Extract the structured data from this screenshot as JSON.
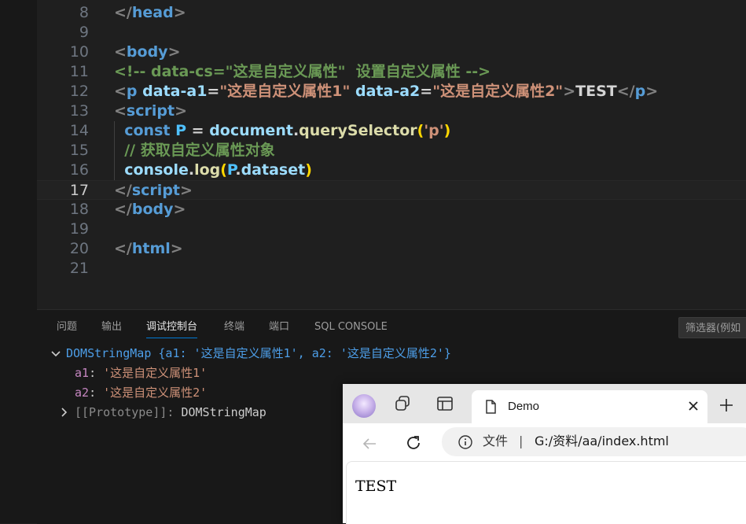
{
  "editor": {
    "lines": [
      {
        "num": "8",
        "tokens": [
          {
            "t": "punc",
            "v": "</"
          },
          {
            "t": "tag",
            "v": "head"
          },
          {
            "t": "punc",
            "v": ">"
          }
        ]
      },
      {
        "num": "9",
        "tokens": []
      },
      {
        "num": "10",
        "tokens": [
          {
            "t": "punc",
            "v": "<"
          },
          {
            "t": "tag",
            "v": "body"
          },
          {
            "t": "punc",
            "v": ">"
          }
        ]
      },
      {
        "num": "11",
        "tokens": [
          {
            "t": "cmt",
            "v": "<!-- data-cs=\"这是自定义属性\"  设置自定义属性 -->"
          }
        ]
      },
      {
        "num": "12",
        "tokens": [
          {
            "t": "punc",
            "v": "<"
          },
          {
            "t": "tag",
            "v": "p"
          },
          {
            "t": "plain",
            "v": " "
          },
          {
            "t": "attr",
            "v": "data-a1"
          },
          {
            "t": "plain",
            "v": "="
          },
          {
            "t": "str",
            "v": "\"这是自定义属性1\""
          },
          {
            "t": "plain",
            "v": " "
          },
          {
            "t": "attr",
            "v": "data-a2"
          },
          {
            "t": "plain",
            "v": "="
          },
          {
            "t": "str",
            "v": "\"这是自定义属性2\""
          },
          {
            "t": "punc",
            "v": ">"
          },
          {
            "t": "plain",
            "v": "TEST"
          },
          {
            "t": "punc",
            "v": "</"
          },
          {
            "t": "tag",
            "v": "p"
          },
          {
            "t": "punc",
            "v": ">"
          }
        ]
      },
      {
        "num": "13",
        "tokens": [
          {
            "t": "punc",
            "v": "<"
          },
          {
            "t": "tag",
            "v": "script"
          },
          {
            "t": "punc",
            "v": ">"
          }
        ]
      },
      {
        "num": "14",
        "tokens": [
          {
            "t": "plain",
            "v": "  "
          },
          {
            "t": "kw",
            "v": "const"
          },
          {
            "t": "plain",
            "v": " "
          },
          {
            "t": "var",
            "v": "P"
          },
          {
            "t": "plain",
            "v": " = "
          },
          {
            "t": "attr",
            "v": "document"
          },
          {
            "t": "plain",
            "v": "."
          },
          {
            "t": "fn",
            "v": "querySelector"
          },
          {
            "t": "br",
            "v": "("
          },
          {
            "t": "str",
            "v": "'p'"
          },
          {
            "t": "br",
            "v": ")"
          }
        ]
      },
      {
        "num": "15",
        "tokens": [
          {
            "t": "plain",
            "v": "  "
          },
          {
            "t": "cmt",
            "v": "// 获取自定义属性对象"
          }
        ]
      },
      {
        "num": "16",
        "tokens": [
          {
            "t": "plain",
            "v": "  "
          },
          {
            "t": "attr",
            "v": "console"
          },
          {
            "t": "plain",
            "v": "."
          },
          {
            "t": "fn",
            "v": "log"
          },
          {
            "t": "br",
            "v": "("
          },
          {
            "t": "var",
            "v": "P"
          },
          {
            "t": "plain",
            "v": "."
          },
          {
            "t": "attr",
            "v": "dataset"
          },
          {
            "t": "br",
            "v": ")"
          }
        ]
      },
      {
        "num": "17",
        "current": true,
        "tokens": [
          {
            "t": "punc",
            "v": "</"
          },
          {
            "t": "tag",
            "v": "script"
          },
          {
            "t": "punc",
            "v": ">"
          }
        ]
      },
      {
        "num": "18",
        "tokens": [
          {
            "t": "punc",
            "v": "</"
          },
          {
            "t": "tag",
            "v": "body"
          },
          {
            "t": "punc",
            "v": ">"
          }
        ]
      },
      {
        "num": "19",
        "tokens": []
      },
      {
        "num": "20",
        "tokens": [
          {
            "t": "punc",
            "v": "</"
          },
          {
            "t": "tag",
            "v": "html"
          },
          {
            "t": "punc",
            "v": ">"
          }
        ]
      },
      {
        "num": "21",
        "tokens": []
      }
    ]
  },
  "panel": {
    "tabs": [
      "问题",
      "输出",
      "调试控制台",
      "终端",
      "端口",
      "SQL CONSOLE"
    ],
    "active_tab": "调试控制台",
    "filter_placeholder": "筛选器(例如"
  },
  "console": {
    "object_summary": "DOMStringMap {a1: '这是自定义属性1', a2: '这是自定义属性2'}",
    "props": [
      {
        "key": "a1",
        "value": "'这是自定义属性1'"
      },
      {
        "key": "a2",
        "value": "'这是自定义属性2'"
      }
    ],
    "prototype_label": "[[Prototype]]",
    "prototype_value": "DOMStringMap"
  },
  "browser": {
    "tab_title": "Demo",
    "address_prefix": "文件",
    "address_sep": "|",
    "address_path": "G:/资料/aa/index.html",
    "page_text": "TEST"
  }
}
